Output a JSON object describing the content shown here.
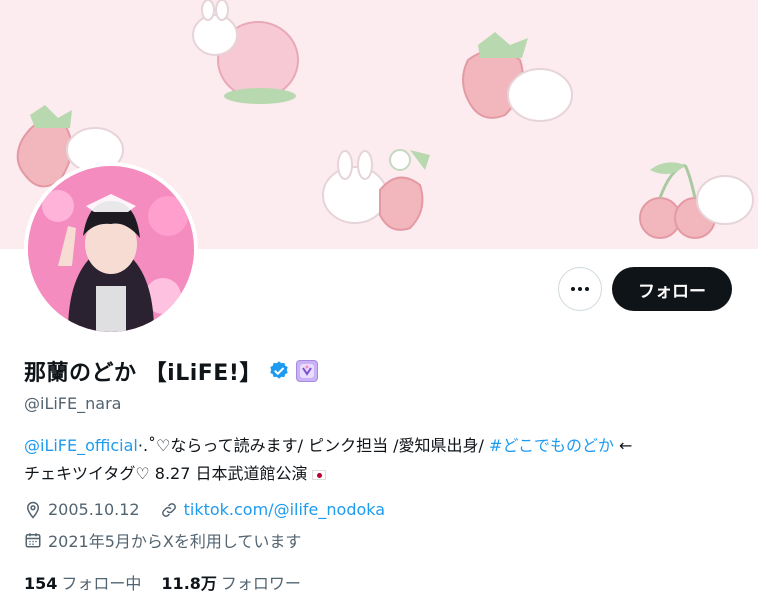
{
  "profile": {
    "display_name": "那蘭のどか 【iLiFE!】",
    "handle": "@iLiFE_nara",
    "bio": {
      "mention": "@iLiFE_official",
      "text1": "·.˚♡ならって読みます/ ピンク担当 /愛知県出身/ ",
      "hashtag": "#どこでものどか",
      "text2": " ←",
      "line2": "チェキツイタグ♡ 8.27 日本武道館公演"
    },
    "birthday": "2005.10.12",
    "link": "tiktok.com/@ilife_nodoka",
    "joined": "2021年5月からXを利用しています",
    "following_count": "154",
    "following_label": "フォロー中",
    "followers_count": "11.8万",
    "followers_label": "フォロワー"
  },
  "actions": {
    "follow_label": "フォロー",
    "more_label": "···"
  },
  "icons": [
    "verified-icon",
    "affiliate-badge-icon",
    "location-icon",
    "link-icon",
    "calendar-icon",
    "more-icon",
    "flag-icon"
  ],
  "colors": {
    "accent": "#1d9bf0",
    "banner": "#fcecef",
    "button": "#0f1419"
  }
}
